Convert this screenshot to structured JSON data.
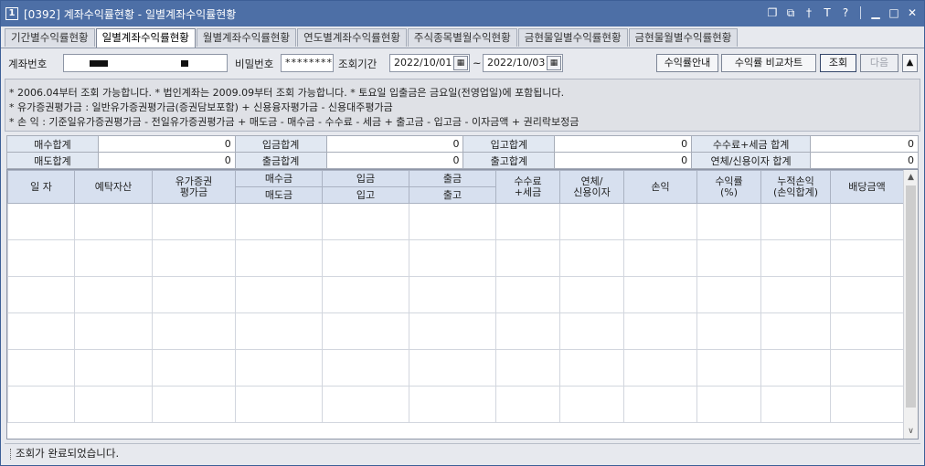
{
  "window": {
    "icon_number": "1",
    "title": "[0392] 계좌수익률현황 - 일별계좌수익률현황"
  },
  "title_icons": [
    "restore-icon",
    "popout-icon",
    "pin-icon",
    "font-icon",
    "help-icon",
    "minimize-icon",
    "maximize-icon",
    "close-icon"
  ],
  "tabs": [
    {
      "label": "기간별수익률현황",
      "active": false
    },
    {
      "label": "일별계좌수익률현황",
      "active": true
    },
    {
      "label": "월별계좌수익률현황",
      "active": false
    },
    {
      "label": "연도별계좌수익률현황",
      "active": false
    },
    {
      "label": "주식종목별월수익현황",
      "active": false
    },
    {
      "label": "금현물일별수익률현황",
      "active": false
    },
    {
      "label": "금현물월별수익률현황",
      "active": false
    }
  ],
  "query": {
    "account_label": "계좌번호",
    "password_label": "비밀번호",
    "password_value": "********",
    "period_label": "조회기간",
    "date_from": "2022/10/01",
    "date_to": "2022/10/03",
    "tilde": "~",
    "btn_guide": "수익률안내",
    "btn_chart": "수익률 비교차트",
    "btn_search": "조회",
    "btn_next": "다음",
    "btn_up": "▲"
  },
  "notes": [
    "* 2006.04부터 조회 가능합니다.   * 법인계좌는 2009.09부터 조회 가능합니다.   * 토요일 입출금은 금요일(전영업일)에 포함됩니다.",
    "* 유가증권평가금 : 일반유가증권평가금(증권담보포함) + 신용융자평가금 - 신용대주평가금",
    "* 손         익 : 기준일유가증권평가금 - 전일유가증권평가금 + 매도금 - 매수금 - 수수료 - 세금 + 출고금 - 입고금 - 이자금액 + 권리락보정금"
  ],
  "summary": {
    "row1": [
      {
        "label": "매수합계",
        "value": "0"
      },
      {
        "label": "입금합계",
        "value": "0"
      },
      {
        "label": "입고합계",
        "value": "0"
      },
      {
        "label": "수수료+세금 합계",
        "value": "0"
      }
    ],
    "row2": [
      {
        "label": "매도합계",
        "value": "0"
      },
      {
        "label": "출금합계",
        "value": "0"
      },
      {
        "label": "출고합계",
        "value": "0"
      },
      {
        "label": "연체/신용이자 합계",
        "value": "0"
      }
    ]
  },
  "grid": {
    "headers": {
      "date": "일 자",
      "deposit": "예탁자산",
      "sec_eval_1": "유가증권",
      "sec_eval_2": "평가금",
      "buy": "매수금",
      "sell": "매도금",
      "deposit_in": "입금",
      "stock_in": "입고",
      "withdraw": "출금",
      "stock_out": "출고",
      "fee_1": "수수료",
      "fee_2": "+세금",
      "interest_1": "연체/",
      "interest_2": "신용이자",
      "pnl": "손익",
      "rate_1": "수익률",
      "rate_2": "(%)",
      "cum_1": "누적손익",
      "cum_2": "(손익합계)",
      "dividend": "배당금액"
    },
    "rows": [
      [
        "",
        "",
        "",
        "",
        "",
        "",
        "",
        "",
        "",
        "",
        ""
      ],
      [
        "",
        "",
        "",
        "",
        "",
        "",
        "",
        "",
        "",
        "",
        ""
      ],
      [
        "",
        "",
        "",
        "",
        "",
        "",
        "",
        "",
        "",
        "",
        ""
      ],
      [
        "",
        "",
        "",
        "",
        "",
        "",
        "",
        "",
        "",
        "",
        ""
      ],
      [
        "",
        "",
        "",
        "",
        "",
        "",
        "",
        "",
        "",
        "",
        ""
      ],
      [
        "",
        "",
        "",
        "",
        "",
        "",
        "",
        "",
        "",
        "",
        ""
      ]
    ]
  },
  "status": {
    "message": "조회가 완료되었습니다."
  }
}
